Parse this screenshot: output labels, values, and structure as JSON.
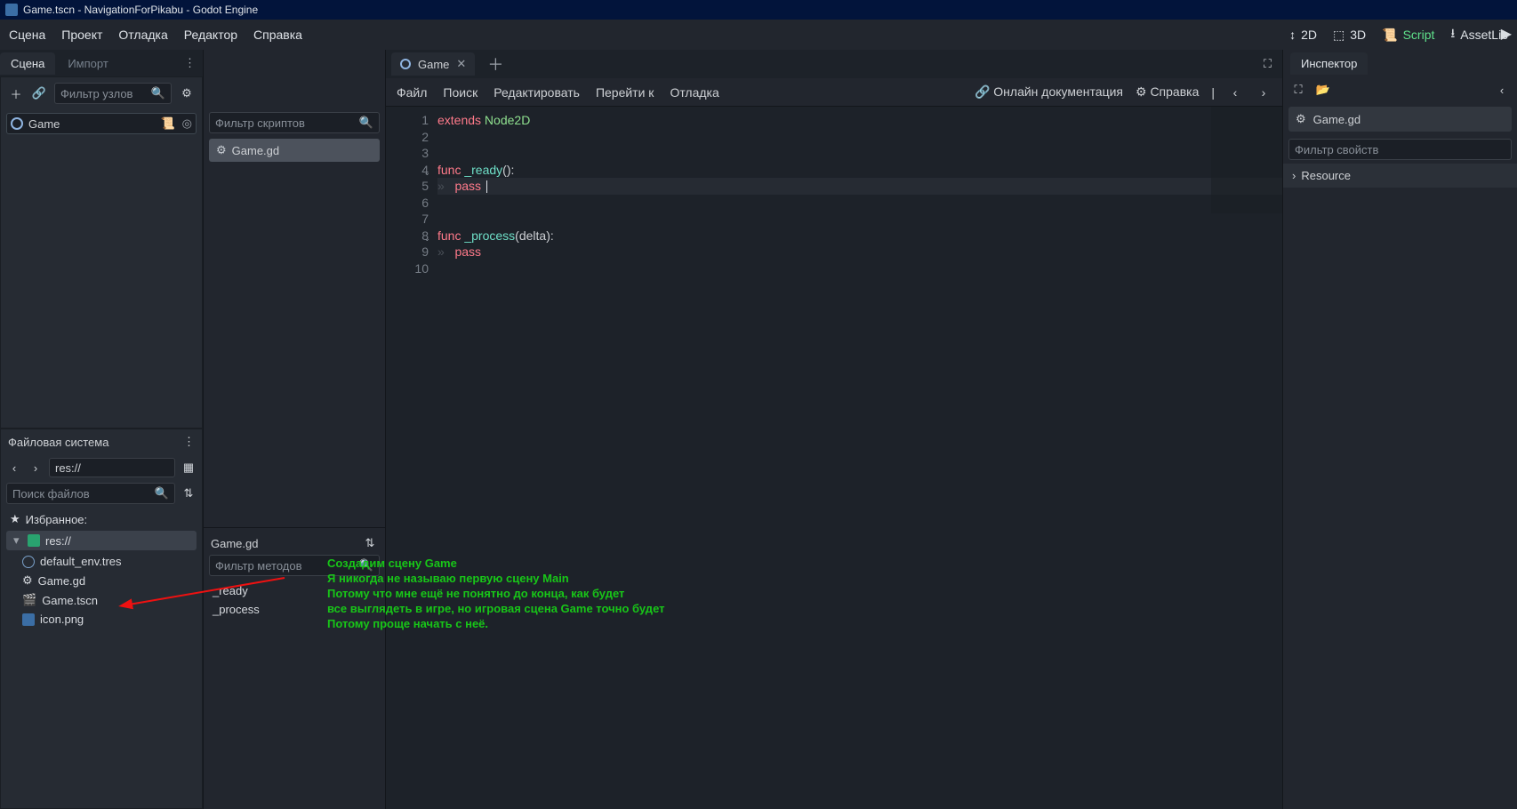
{
  "title": "Game.tscn - NavigationForPikabu - Godot Engine",
  "menu": {
    "scene": "Сцена",
    "project": "Проект",
    "debug": "Отладка",
    "editor": "Редактор",
    "help": "Справка"
  },
  "workspaces": {
    "w2d": "2D",
    "w3d": "3D",
    "script": "Script",
    "assetlib": "AssetLib"
  },
  "left": {
    "tab_scene": "Сцена",
    "tab_import": "Импорт",
    "filter_nodes_ph": "Фильтр узлов",
    "root_node": "Game",
    "fs_title": "Файловая система",
    "path": "res://",
    "search_files_ph": "Поиск файлов",
    "fav": "Избранное:",
    "files": [
      "default_env.tres",
      "Game.gd",
      "Game.tscn",
      "icon.png"
    ]
  },
  "mid1": {
    "filter_scripts_ph": "Фильтр скриптов",
    "script": "Game.gd",
    "current": "Game.gd",
    "filter_methods_ph": "Фильтр методов",
    "methods": [
      "_ready",
      "_process"
    ]
  },
  "main": {
    "tab": "Game",
    "menus": {
      "file": "Файл",
      "search": "Поиск",
      "edit": "Редактировать",
      "goto": "Перейти к",
      "debug": "Отладка"
    },
    "online_doc": "Онлайн документация",
    "help": "Справка",
    "code": {
      "lines": [
        {
          "n": 1,
          "seg": [
            [
              "kw",
              "extends"
            ],
            [
              "",
              ""
            ],
            [
              "ty",
              " Node2D"
            ]
          ]
        },
        {
          "n": 2,
          "seg": []
        },
        {
          "n": 3,
          "seg": []
        },
        {
          "n": 4,
          "fold": true,
          "seg": [
            [
              "kw",
              "func"
            ],
            [
              "",
              " "
            ],
            [
              "id",
              "_ready"
            ],
            [
              "",
              "():"
            ]
          ]
        },
        {
          "n": 5,
          "hl": true,
          "indent": true,
          "seg": [
            [
              "kw",
              "pass"
            ],
            [
              "",
              ""
            ]
          ],
          "caret": true
        },
        {
          "n": 6,
          "seg": []
        },
        {
          "n": 7,
          "seg": []
        },
        {
          "n": 8,
          "fold": true,
          "seg": [
            [
              "kw",
              "func"
            ],
            [
              "",
              " "
            ],
            [
              "id",
              "_process"
            ],
            [
              "",
              "(delta):"
            ]
          ]
        },
        {
          "n": 9,
          "indent": true,
          "seg": [
            [
              "kw",
              "pass"
            ]
          ]
        },
        {
          "n": 10,
          "seg": []
        }
      ]
    }
  },
  "right": {
    "tab": "Инспектор",
    "obj": "Game.gd",
    "filter_ph": "Фильтр свойств",
    "cat": "Resource"
  },
  "annot": "Создадим сцену Game\nЯ никогда не называю первую сцену Main\nПотому что мне ещё не понятно до конца, как будет\nвсе выглядеть в игре, но игровая сцена Game точно будет\nПотому проще начать с неё."
}
